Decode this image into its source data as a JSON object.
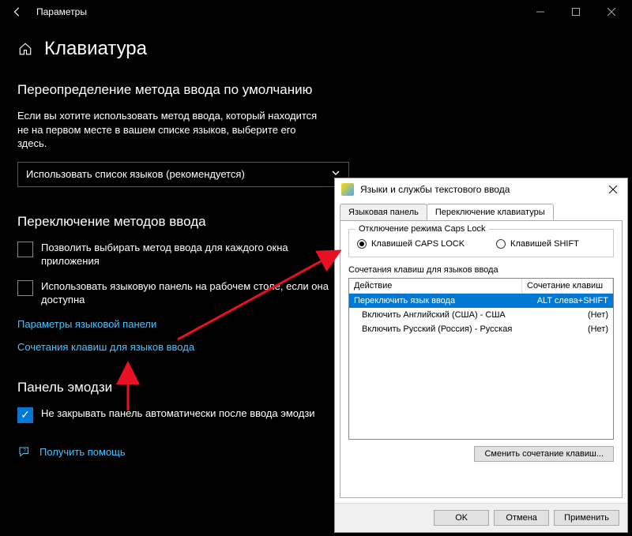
{
  "window": {
    "title": "Параметры"
  },
  "page": {
    "heading": "Клавиатура",
    "section_override": {
      "title": "Переопределение метода ввода по умолчанию",
      "desc": "Если вы хотите использовать метод ввода, который находится не на первом месте в вашем списке языков, выберите его здесь.",
      "dropdown_value": "Использовать список языков (рекомендуется)"
    },
    "section_switch": {
      "title": "Переключение методов ввода",
      "cb1": "Позволить выбирать метод ввода для каждого окна приложения",
      "cb2": "Использовать языковую панель на рабочем столе, если она доступна",
      "link1": "Параметры языковой панели",
      "link2": "Сочетания клавиш для языков ввода"
    },
    "section_emoji": {
      "title": "Панель эмодзи",
      "cb": "Не закрывать панель автоматически после ввода эмодзи"
    },
    "help_link": "Получить помощь"
  },
  "dialog": {
    "title": "Языки и службы текстового ввода",
    "tab1": "Языковая панель",
    "tab2": "Переключение клавиатуры",
    "capslock_group": "Отключение режима Caps Lock",
    "radio_caps": "Клавишей CAPS LOCK",
    "radio_shift": "Клавишей SHIFT",
    "hotkey_heading": "Сочетания клавиш для языков ввода",
    "col_action": "Действие",
    "col_combo": "Сочетание клавиш",
    "rows": [
      {
        "action": "Переключить язык ввода",
        "combo": "ALT слева+SHIFT",
        "selected": true,
        "indent": false
      },
      {
        "action": "Включить Английский (США) - США",
        "combo": "(Нет)",
        "selected": false,
        "indent": true
      },
      {
        "action": "Включить Русский (Россия) - Русская",
        "combo": "(Нет)",
        "selected": false,
        "indent": true
      }
    ],
    "change_btn": "Сменить сочетание клавиш...",
    "ok": "OK",
    "cancel": "Отмена",
    "apply": "Применить"
  }
}
